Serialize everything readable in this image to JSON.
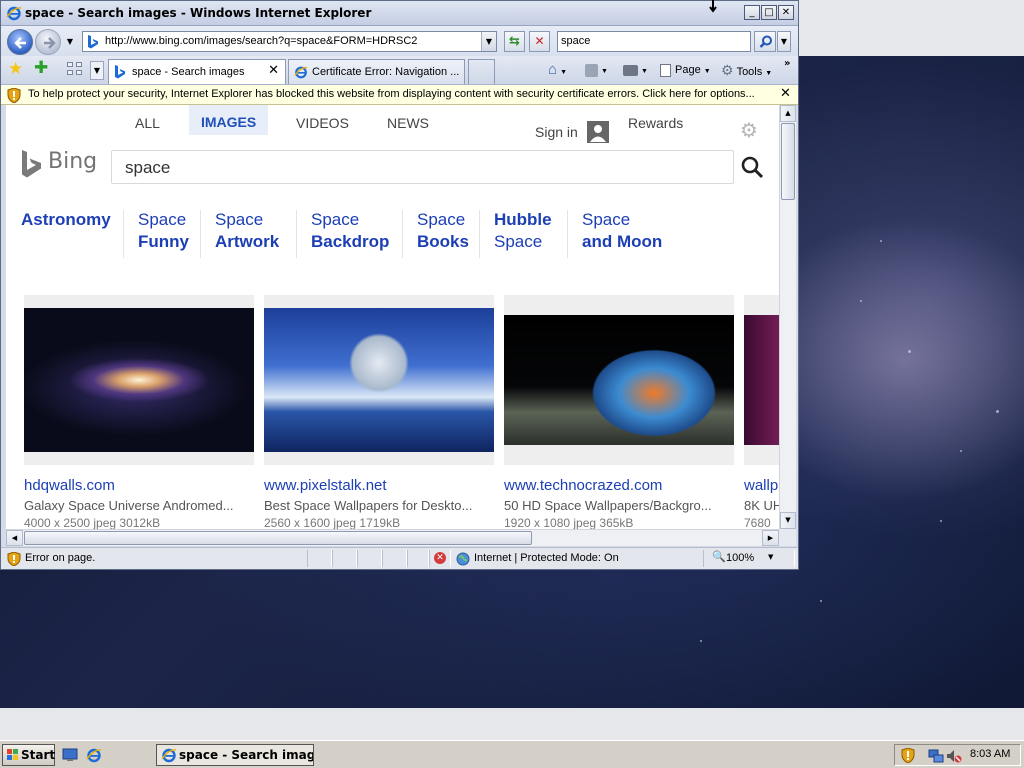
{
  "window": {
    "title": "space - Search images - Windows Internet Explorer",
    "min_label": "_",
    "max_label": "□",
    "close_label": "✕"
  },
  "navbar": {
    "address": "http://www.bing.com/images/search?q=space&FORM=HDRSC2",
    "search_query": "space"
  },
  "tabs": {
    "active_label": "space - Search images",
    "inactive_label": "Certificate Error: Navigation ...",
    "close_label": "✕"
  },
  "command_bar": {
    "page_label": "Page",
    "tools_label": "Tools"
  },
  "infobar": {
    "text": "To help protect your security, Internet Explorer has blocked this website from displaying content with security certificate errors. Click here for options...",
    "close_label": "✕"
  },
  "bing": {
    "nav": [
      "ALL",
      "IMAGES",
      "VIDEOS",
      "NEWS"
    ],
    "signin_label": "Sign in",
    "rewards_label": "Rewards",
    "logo_text": "Bing",
    "search_value": "space",
    "related": [
      {
        "line1": "Astronomy",
        "line2": ""
      },
      {
        "line1": "Space",
        "line2": "Funny"
      },
      {
        "line1": "Space",
        "line2": "Artwork"
      },
      {
        "line1": "Space",
        "line2": "Backdrop"
      },
      {
        "line1": "Space",
        "line2": "Books"
      },
      {
        "line1": "Hubble",
        "line2": "Space"
      },
      {
        "line1": "Space",
        "line2": "and Moon"
      }
    ],
    "results": [
      {
        "domain": "hdqwalls.com",
        "desc": "Galaxy Space Universe Andromed...",
        "meta": "4000 x 2500 jpeg 3012kB"
      },
      {
        "domain": "www.pixelstalk.net",
        "desc": "Best Space Wallpapers for Deskto...",
        "meta": "2560 x 1600 jpeg 1719kB"
      },
      {
        "domain": "www.technocrazed.com",
        "desc": "50 HD Space Wallpapers/Backgro...",
        "meta": "1920 x 1080 jpeg 365kB"
      },
      {
        "domain": "wallp",
        "desc": "8K UH",
        "meta": "7680"
      }
    ]
  },
  "statusbar": {
    "text": "Error on page.",
    "zone": "Internet | Protected Mode: On",
    "zoom": "100%"
  },
  "taskbar": {
    "start_label": "Start",
    "task_label": "space - Search image...",
    "clock": "8:03 AM"
  },
  "colors": {
    "bing_link": "#1c3fb5",
    "bing_nav_active": "#1f4fb8",
    "infobar_bg": "#ffffe1",
    "titlebar": "#c4cee3"
  },
  "icons": [
    "ie-icon",
    "bing-favicon",
    "back-arrow-icon",
    "forward-arrow-icon",
    "refresh-icon",
    "stop-icon",
    "search-icon",
    "favorites-star-icon",
    "add-favorites-icon",
    "quick-tabs-icon",
    "home-icon",
    "feeds-icon",
    "print-icon",
    "page-icon",
    "tools-gear-icon",
    "shield-icon",
    "gear-icon",
    "user-avatar-icon",
    "warning-icon",
    "globe-icon",
    "zoom-icon",
    "windows-logo-icon",
    "clock"
  ]
}
